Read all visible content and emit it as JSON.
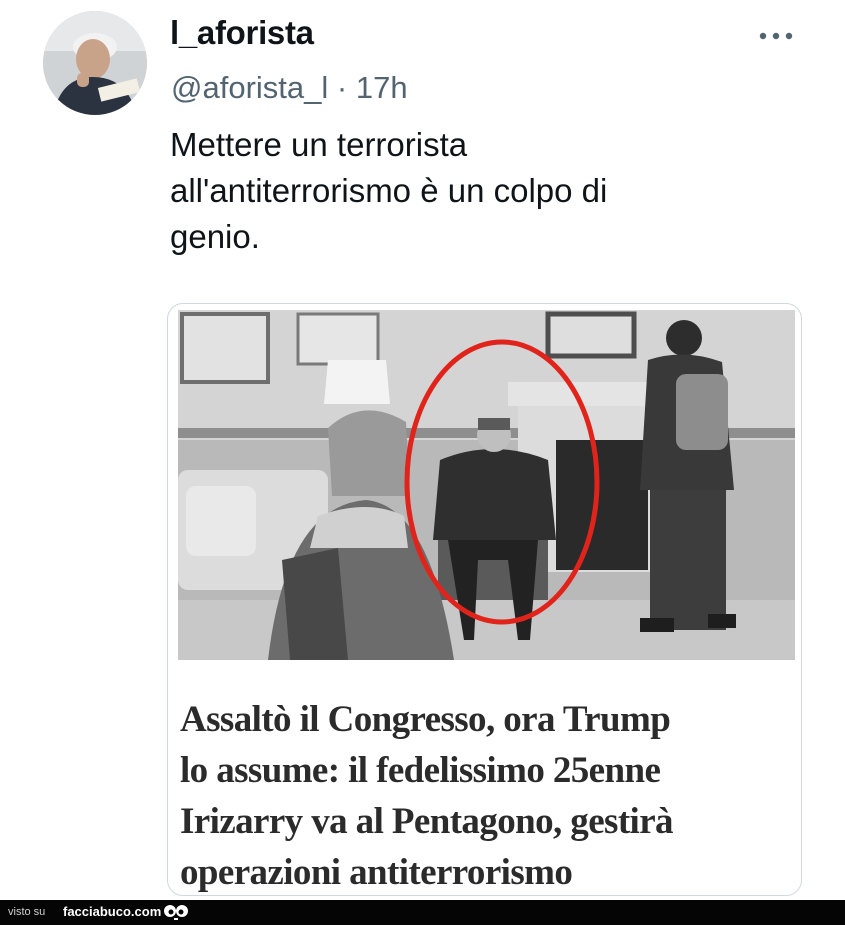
{
  "tweet": {
    "display_name": "l_aforista",
    "handle": "@aforista_l",
    "separator": "·",
    "time": "17h",
    "more_icon": "more-horizontal-icon",
    "text_lines": [
      "Mettere un terrorista",
      "all'antiterrorismo è un colpo di",
      "genio."
    ]
  },
  "card": {
    "headline_lines": [
      "Assaltò il Congresso, ora Trump",
      "lo assume: il fedelissimo 25enne",
      "Irizarry va al Pentagono, gestirà",
      "operazioni antiterrorismo"
    ],
    "highlight_color": "#e0241b"
  },
  "watermark": {
    "prefix": "visto su",
    "site": "facciabuco.com"
  },
  "colors": {
    "text": "#0f1419",
    "secondary": "#536471",
    "border": "#cfd9de"
  }
}
